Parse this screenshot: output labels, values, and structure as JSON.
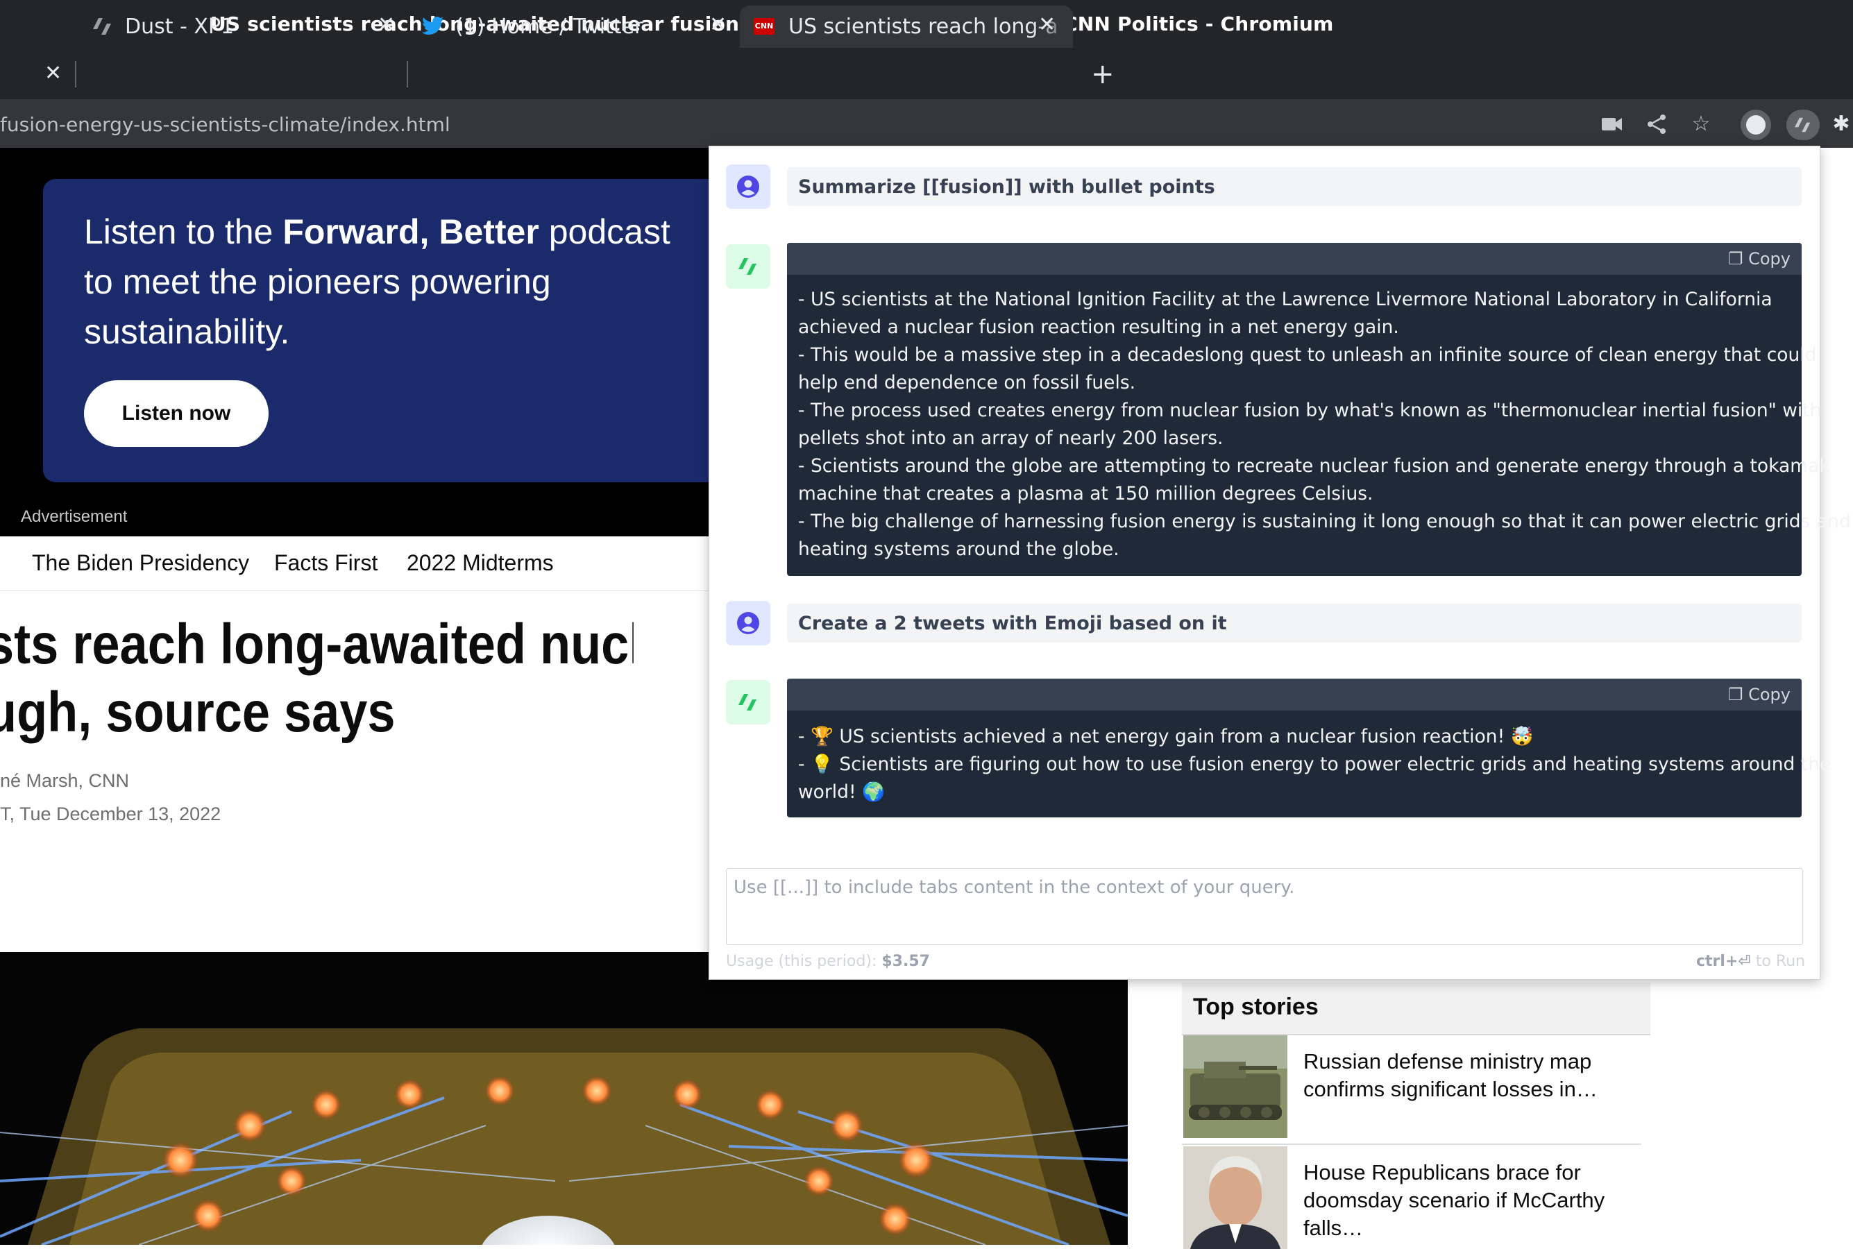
{
  "window": {
    "title": "US scientists reach long-awaited nuclear fusion breakthrough, source says | CNN Politics - Chromium"
  },
  "tabs": [
    {
      "label": "Dust - XP1",
      "icon": "dust-icon"
    },
    {
      "label": "(1) Home / Twitter",
      "icon": "twitter-icon"
    },
    {
      "label": "US scientists reach long-a",
      "icon": "cnn-icon",
      "active": true
    }
  ],
  "addressbar": {
    "url": "fusion-energy-us-scientists-climate/index.html"
  },
  "ad": {
    "text_pre": "Listen to the ",
    "text_bold": "Forward, Better",
    "text_post": " podcast to meet the pioneers powering sustainability.",
    "button": "Listen now",
    "label": "Advertisement"
  },
  "nav": {
    "items": [
      "The Biden Presidency",
      "Facts First",
      "2022 Midterms"
    ]
  },
  "article": {
    "headline_line1": "sts reach long-awaited nucle",
    "headline_line2": "ugh, source says",
    "byline": "né Marsh, CNN",
    "date": "T, Tue December 13, 2022"
  },
  "sidebar": {
    "title": "Top stories",
    "stories": [
      {
        "text": "Russian defense ministry map confirms significant losses in…"
      },
      {
        "text": "House Republicans brace for doomsday scenario if McCarthy falls…"
      }
    ]
  },
  "dust": {
    "messages": [
      {
        "role": "user",
        "text": "Summarize [[fusion]] with bullet points"
      },
      {
        "role": "assistant",
        "copy_label": "Copy",
        "lines": [
          "- US scientists at the National Ignition Facility at the Lawrence Livermore National Laboratory in California",
          "achieved a nuclear fusion reaction resulting in a net energy gain.",
          "- This would be a massive step in a decadeslong quest to unleash an infinite source of clean energy that could",
          "help end dependence on fossil fuels.",
          "- The process used creates energy from nuclear fusion by what's known as \"thermonuclear inertial fusion\" with",
          "pellets shot into an array of nearly 200 lasers.",
          "- Scientists around the globe are attempting to recreate nuclear fusion and generate energy through a tokamak",
          "machine that creates a plasma at 150 million degrees Celsius.",
          "- The big challenge of harnessing fusion energy is sustaining it long enough so that it can power electric grids and",
          "heating systems around the globe."
        ]
      },
      {
        "role": "user",
        "text": "Create a 2 tweets with Emoji based on it"
      },
      {
        "role": "assistant",
        "copy_label": "Copy",
        "lines": [
          "- 🏆 US scientists achieved a net energy gain from a nuclear fusion reaction! 🤯",
          "- 💡 Scientists are figuring out how to use fusion energy to power electric grids and heating systems around the",
          "world! 🌍"
        ]
      }
    ],
    "input_placeholder": "Use [[...]] to include tabs content in the context of your query.",
    "usage_label": "Usage (this period): ",
    "usage_value": "$3.57",
    "run_key": "ctrl+⏎",
    "run_label": " to Run"
  },
  "colors": {
    "chrome_dark": "#232528",
    "chrome_tab": "#35363a",
    "ad_blue": "#1a2a6b",
    "answer_bg": "#1f2937",
    "user_avatar": "#4f46e5",
    "bot_avatar": "#22c55e"
  }
}
